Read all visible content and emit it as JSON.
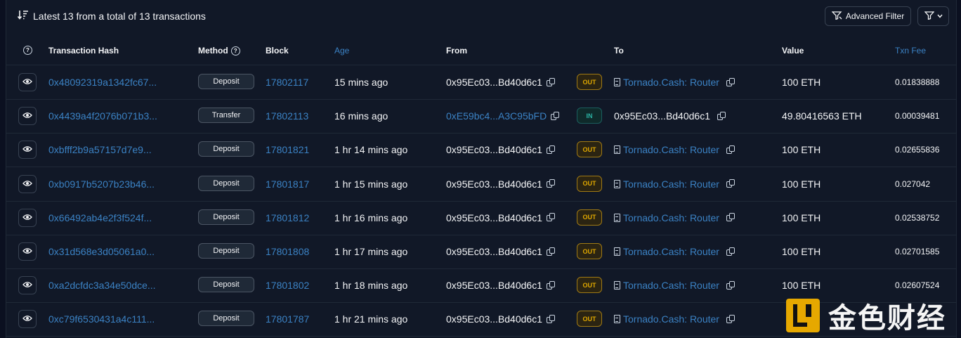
{
  "summary": {
    "text": "Latest 13 from a total of 13 transactions",
    "icon": "sort-desc-icon"
  },
  "toolbar": {
    "advanced_filter_label": "Advanced Filter",
    "filter_icon": "funnel-icon"
  },
  "columns": {
    "hash": "Transaction Hash",
    "method": "Method",
    "block": "Block",
    "age": "Age",
    "from": "From",
    "to": "To",
    "value": "Value",
    "fee": "Txn Fee"
  },
  "colors": {
    "link": "#3b82c4",
    "out": "#e0a800",
    "in": "#2bb3a4",
    "background": "#111827"
  },
  "rows": [
    {
      "hash": "0x48092319a1342fc67...",
      "method": "Deposit",
      "block": "17802117",
      "age": "15 mins ago",
      "from": "0x95Ec03...Bd40d6c1",
      "dir": "OUT",
      "to": "Tornado.Cash: Router",
      "value": "100 ETH",
      "fee": "0.01838888"
    },
    {
      "hash": "0x4439a4f2076b071b3...",
      "method": "Transfer",
      "block": "17802113",
      "age": "16 mins ago",
      "from": "0xE59bc4...A3C95bFD",
      "dir": "IN",
      "to": "0x95Ec03...Bd40d6c1",
      "value": "49.80416563 ETH",
      "fee": "0.00039481"
    },
    {
      "hash": "0xbfff2b9a57157d7e9...",
      "method": "Deposit",
      "block": "17801821",
      "age": "1 hr 14 mins ago",
      "from": "0x95Ec03...Bd40d6c1",
      "dir": "OUT",
      "to": "Tornado.Cash: Router",
      "value": "100 ETH",
      "fee": "0.02655836"
    },
    {
      "hash": "0xb0917b5207b23b46...",
      "method": "Deposit",
      "block": "17801817",
      "age": "1 hr 15 mins ago",
      "from": "0x95Ec03...Bd40d6c1",
      "dir": "OUT",
      "to": "Tornado.Cash: Router",
      "value": "100 ETH",
      "fee": "0.027042"
    },
    {
      "hash": "0x66492ab4e2f3f524f...",
      "method": "Deposit",
      "block": "17801812",
      "age": "1 hr 16 mins ago",
      "from": "0x95Ec03...Bd40d6c1",
      "dir": "OUT",
      "to": "Tornado.Cash: Router",
      "value": "100 ETH",
      "fee": "0.02538752"
    },
    {
      "hash": "0x31d568e3d05061a0...",
      "method": "Deposit",
      "block": "17801808",
      "age": "1 hr 17 mins ago",
      "from": "0x95Ec03...Bd40d6c1",
      "dir": "OUT",
      "to": "Tornado.Cash: Router",
      "value": "100 ETH",
      "fee": "0.02701585"
    },
    {
      "hash": "0xa2dcfdc3a34e50dce...",
      "method": "Deposit",
      "block": "17801802",
      "age": "1 hr 18 mins ago",
      "from": "0x95Ec03...Bd40d6c1",
      "dir": "OUT",
      "to": "Tornado.Cash: Router",
      "value": "100 ETH",
      "fee": "0.02607524"
    },
    {
      "hash": "0xc79f6530431a4c111...",
      "method": "Deposit",
      "block": "17801787",
      "age": "1 hr 21 mins ago",
      "from": "0x95Ec03...Bd40d6c1",
      "dir": "OUT",
      "to": "Tornado.Cash: Router",
      "value": "",
      "fee": ""
    }
  ],
  "watermark": {
    "text": "金色财经"
  }
}
